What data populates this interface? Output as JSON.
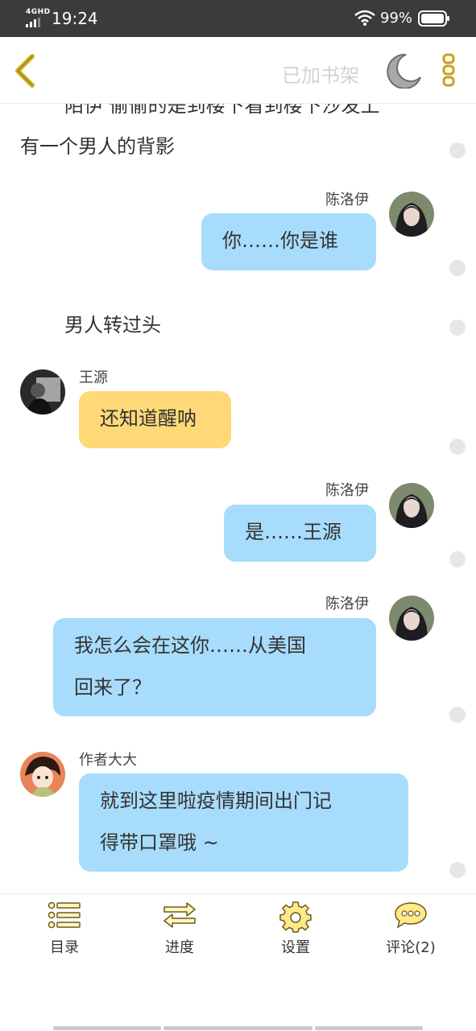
{
  "status_bar": {
    "network": "4GHD",
    "time": "19:24",
    "battery": "99%"
  },
  "header": {
    "shelf_label": "已加书架"
  },
  "story": {
    "narration_cut": "陌伊 偷偷的是到楼下看到楼下沙发上",
    "narration_1": "有一个男人的背影",
    "msg1_name": "陈洛伊",
    "msg1_text": "你……你是谁",
    "narration_2": "男人转过头",
    "msg2_name": "王源",
    "msg2_text": "还知道醒呐",
    "msg3_name": "陈洛伊",
    "msg3_text": "是……王源",
    "msg4_name": "陈洛伊",
    "msg4_line1": "我怎么会在这你……从美国",
    "msg4_line2": "回来了？",
    "msg5_name": "作者大大",
    "msg5_line1": "就到这里啦疫情期间出门记",
    "msg5_line2": "得带口罩哦 ~"
  },
  "bottom_nav": {
    "catalog": "目录",
    "progress": "进度",
    "settings": "设置",
    "comments": "评论(2)"
  },
  "colors": {
    "accent": "#c9a21b",
    "blue_bubble": "#a8dcfc",
    "yellow_bubble": "#ffd977"
  }
}
